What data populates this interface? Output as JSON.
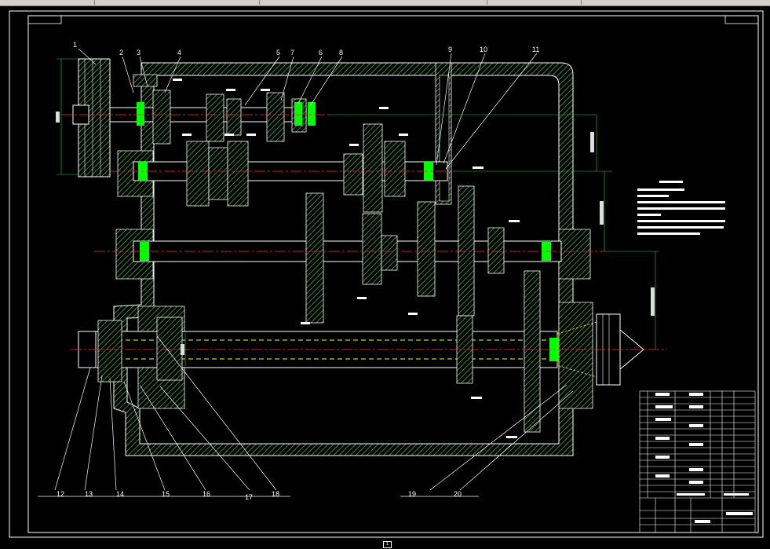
{
  "part_labels": [
    "1",
    "2",
    "3",
    "4",
    "5",
    "7",
    "6",
    "8",
    "9",
    "10",
    "11",
    "12",
    "13",
    "14",
    "15",
    "16",
    "17",
    "18",
    "19",
    "20"
  ],
  "sheet_marker": "1",
  "colors": {
    "background": "#000000",
    "outline": "#ffffff",
    "hatch": "#3fae3f",
    "centerline": "#ff2a2a",
    "dimension": "#33cc33",
    "bearing_highlight": "#00ff00",
    "hidden_line": "#ffff00",
    "frame": "#ffffff"
  }
}
